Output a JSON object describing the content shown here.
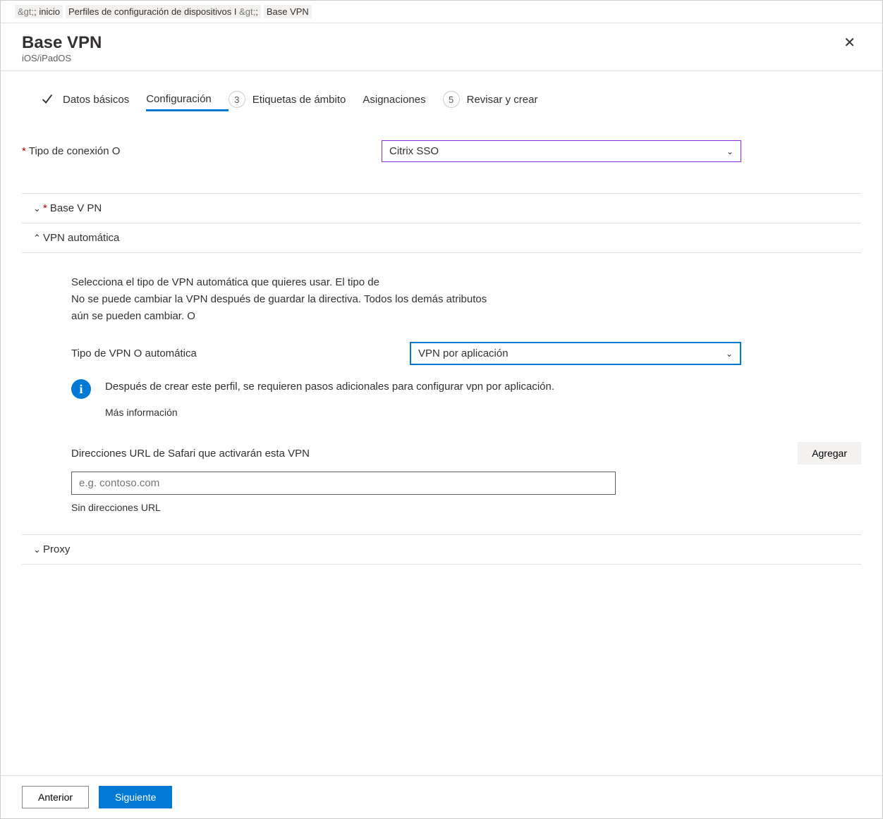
{
  "breadcrumb": {
    "sep1": "&gt;",
    "item1": "inicio",
    "item2": "Perfiles de configuración de dispositivos I",
    "sep2": "&gt;",
    "item3": "Base VPN"
  },
  "header": {
    "title": "Base VPN",
    "subtitle": "iOS/iPadOS"
  },
  "steps": {
    "s1": "Datos básicos",
    "s2": "Configuración",
    "s3num": "3",
    "s3": "Etiquetas de ámbito",
    "s4": "Asignaciones",
    "s5num": "5",
    "s5": "Revisar y crear"
  },
  "fields": {
    "conn_label": "Tipo de conexión O",
    "conn_value": "Citrix SSO"
  },
  "sections": {
    "basevpn": "Base V PN",
    "autovpn": "VPN automática",
    "proxy": "Proxy"
  },
  "auto": {
    "hint1": "Selecciona el tipo de VPN automática que quieres usar. El tipo de",
    "hint2": "No se puede cambiar la VPN después de guardar la directiva. Todos los demás atributos",
    "hint3": "aún se pueden cambiar. O",
    "type_label": "Tipo de VPN O automática",
    "type_value": "VPN por aplicación",
    "info_text": "Después de crear este perfil, se requieren pasos adicionales para configurar vpn por aplicación.",
    "learn": "Más información",
    "urls_label": "Direcciones URL de Safari que activarán esta VPN",
    "add": "Agregar",
    "url_placeholder": "e.g. contoso.com",
    "nourls": "Sin direcciones URL"
  },
  "footer": {
    "prev": "Anterior",
    "next": "Siguiente"
  }
}
